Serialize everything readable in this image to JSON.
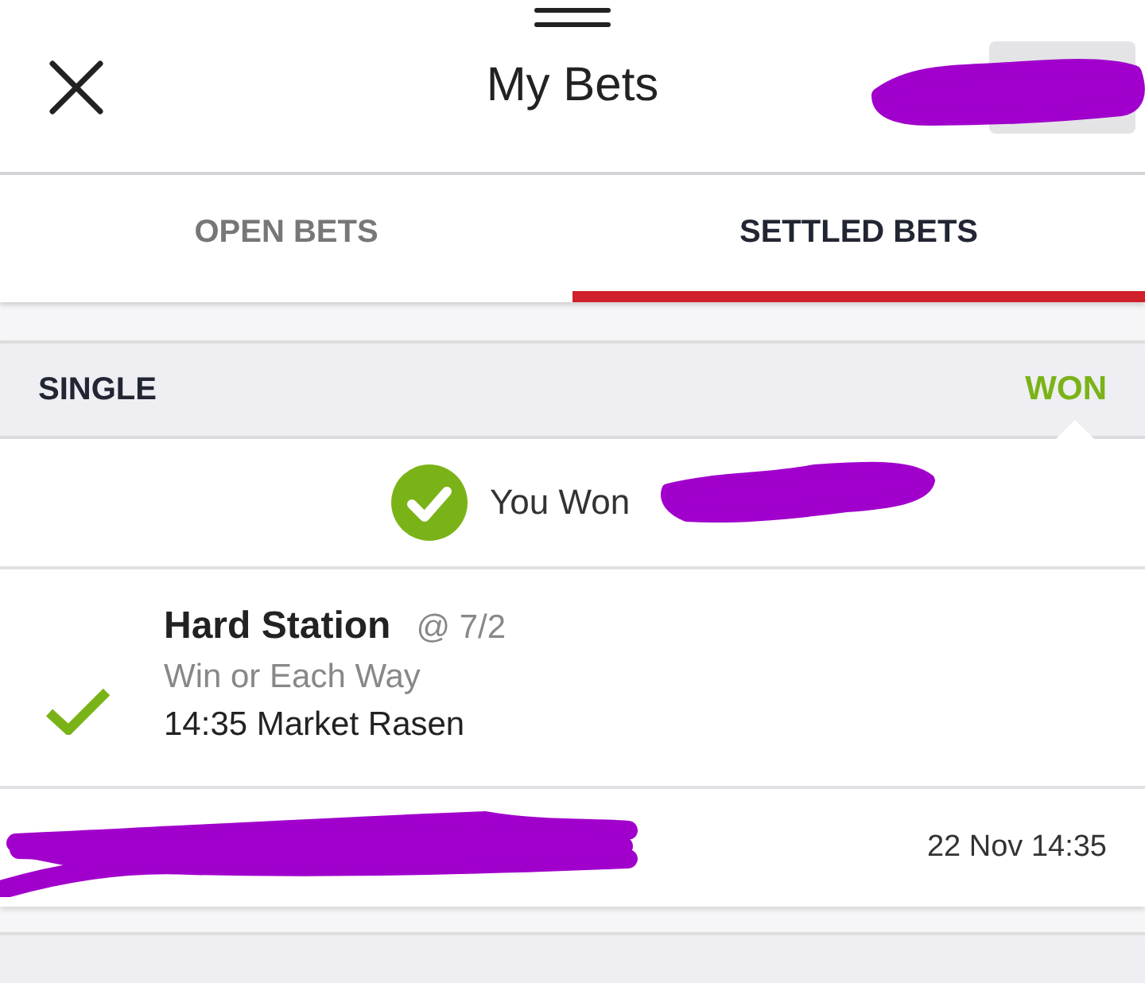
{
  "header": {
    "title": "My Bets"
  },
  "tabs": [
    {
      "label": "OPEN BETS",
      "selected": false
    },
    {
      "label": "SETTLED BETS",
      "selected": true
    }
  ],
  "bet": {
    "type": "SINGLE",
    "result": "WON",
    "won": true,
    "result_text": "You Won",
    "selection": {
      "name": "Hard Station",
      "odds": "@ 7/2",
      "market": "Win or Each Way",
      "event": "14:35 Market Rasen"
    },
    "date": "22 Nov 14:35"
  }
}
